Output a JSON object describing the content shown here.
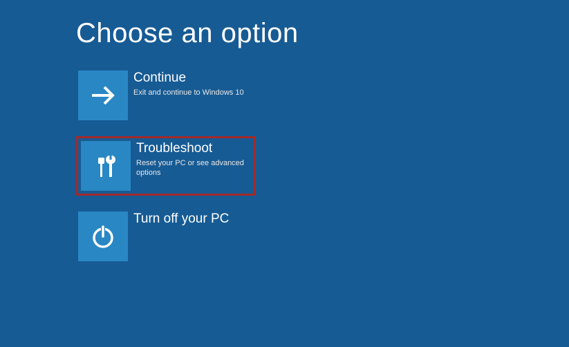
{
  "header": {
    "title": "Choose an option"
  },
  "options": [
    {
      "title": "Continue",
      "subtitle": "Exit and continue to Windows 10",
      "highlighted": false
    },
    {
      "title": "Troubleshoot",
      "subtitle": "Reset your PC or see advanced options",
      "highlighted": true
    },
    {
      "title": "Turn off your PC",
      "subtitle": "",
      "highlighted": false
    }
  ],
  "colors": {
    "background": "#175b94",
    "tile": "#2987c4",
    "highlight": "#a32a2a"
  }
}
